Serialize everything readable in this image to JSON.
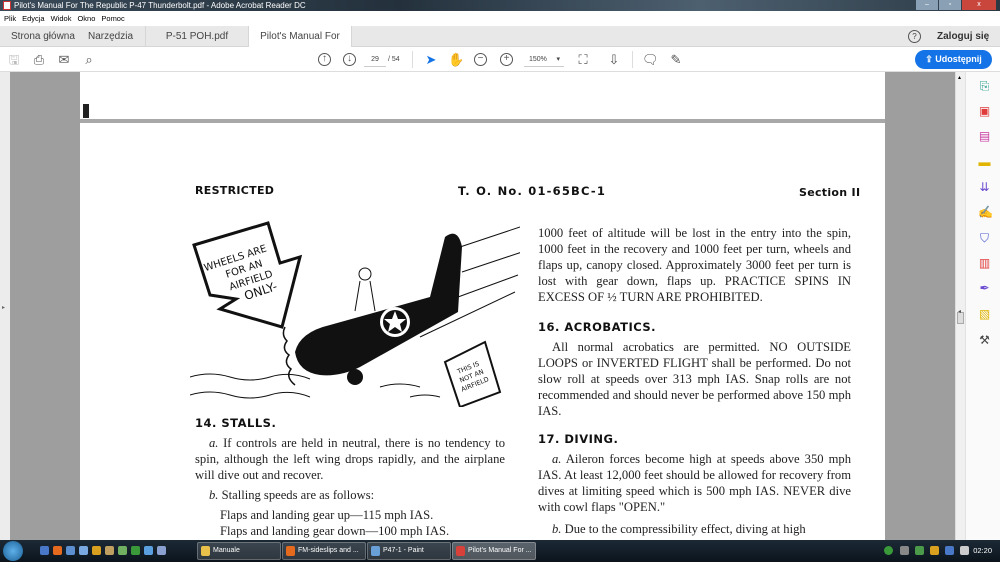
{
  "window": {
    "title": "Pilot's Manual For The Republic P-47 Thunderbolt.pdf - Adobe Acrobat Reader DC",
    "minimize": "–",
    "maximize": "▫",
    "close": "x"
  },
  "menu": [
    "Plik",
    "Edycja",
    "Widok",
    "Okno",
    "Pomoc"
  ],
  "tabs": {
    "home": "Strona główna",
    "tools": "Narzędzia",
    "docs": [
      {
        "label": "P-51 POH.pdf"
      },
      {
        "label": "Pilot's Manual For T...",
        "close": "×"
      }
    ],
    "help": "?",
    "signin": "Zaloguj się"
  },
  "toolbar": {
    "page_current": "29",
    "page_total": "/ 54",
    "zoom": "150%",
    "share": "Udostępnij"
  },
  "document": {
    "header": {
      "left": "RESTRICTED",
      "center": "T. O. No. 01-65BC-1",
      "right": "Section II"
    },
    "illustration": {
      "arrow_sign": [
        "WHEELS ARE",
        "FOR AN",
        "AIRFIELD",
        "ONLY-"
      ],
      "ground_sign": [
        "THIS IS",
        "NOT AN",
        "AIRFIELD"
      ]
    },
    "left_column": {
      "heading": "14. STALLS.",
      "para_a_label": "a.",
      "para_a": " If controls are held in neutral, there is no tendency to spin, although the left wing drops rapidly, and the airplane will dive out and recover.",
      "para_b_label": "b.",
      "para_b": " Stalling speeds are as follows:",
      "speeds": [
        "Flaps and landing gear up—115 mph IAS.",
        "Flaps and landing gear down—100 mph IAS."
      ]
    },
    "right_column": {
      "spin_text": "1000 feet of altitude will be lost in the entry into the spin, 1000 feet in the recovery and 1000 feet per turn, wheels and flaps up, canopy closed.  Approximately 3000 feet per turn is lost with gear down, flaps up. PRACTICE SPINS IN EXCESS OF ½ TURN ARE PROHIBITED.",
      "heading16": "16. ACROBATICS.",
      "acro_text": "All normal acrobatics are permitted.  NO OUTSIDE LOOPS or INVERTED FLIGHT shall be performed. Do not slow roll at speeds over 313 mph IAS. Snap rolls are not recommended and should never be performed above 150 mph IAS.",
      "heading17": "17. DIVING.",
      "dive_a_label": "a.",
      "dive_a": " Aileron forces become high at speeds above 350 mph IAS.  At least 12,000 feet should be allowed for recovery from dives at limiting speed which is 500 mph IAS. NEVER dive with cowl flaps \"OPEN.\"",
      "dive_b_label": "b.",
      "dive_b": " Due to the compressibility effect, diving at high"
    }
  },
  "taskbar": {
    "tasks": [
      "Manuale",
      "FM-sideslips and ...",
      "P47-1 - Paint",
      "Pilot's Manual For ..."
    ],
    "clock": "02:20"
  }
}
